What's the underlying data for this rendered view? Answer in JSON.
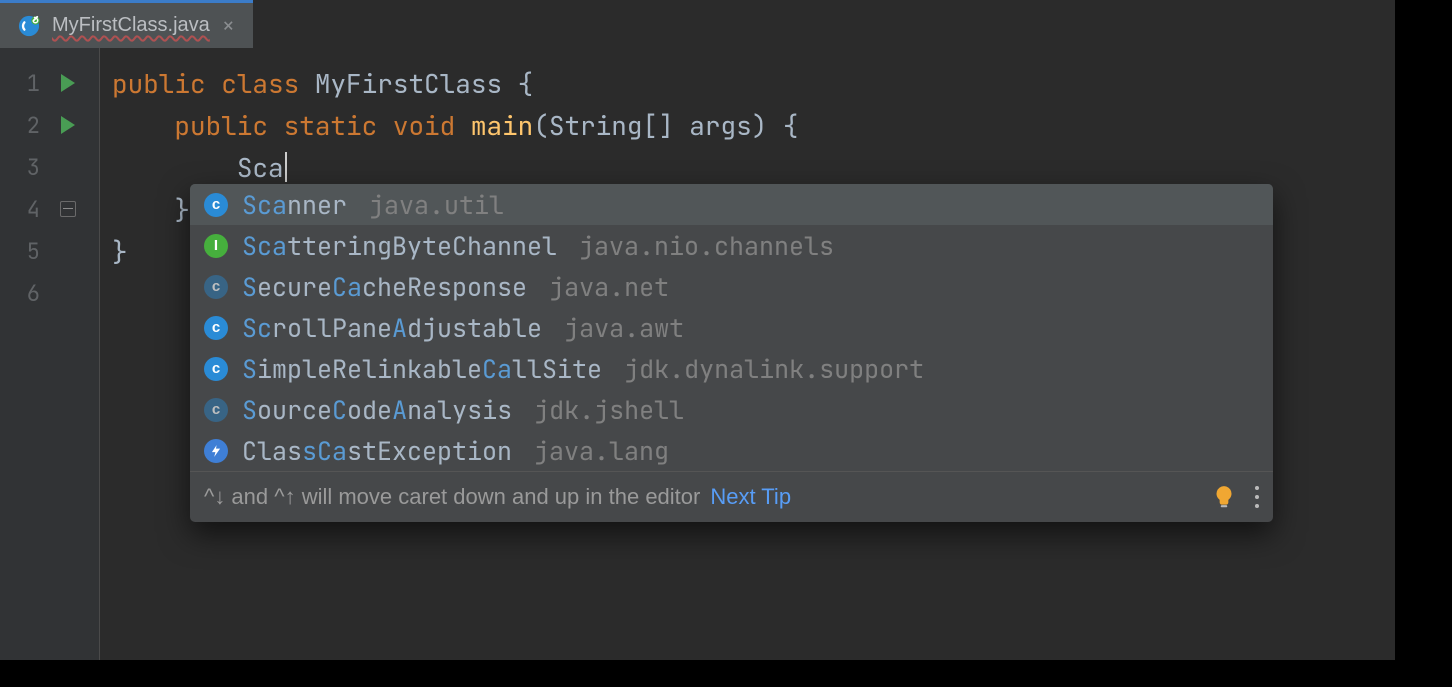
{
  "tab": {
    "filename": "MyFirstClass.java"
  },
  "gutter": {
    "lines": [
      "1",
      "2",
      "3",
      "4",
      "5",
      "6"
    ]
  },
  "code": {
    "l1": {
      "kw1": "public",
      "kw2": "class",
      "name": "MyFirstClass",
      "brace": " {"
    },
    "l2": {
      "indent": "    ",
      "kw1": "public",
      "kw2": "static",
      "kw3": "void",
      "mname": "main",
      "sig": "(String[] args) {"
    },
    "l3": {
      "indent": "        ",
      "typed": "Sca"
    },
    "l4": {
      "indent": "    ",
      "brace": "}"
    },
    "l5": {
      "brace": "}"
    }
  },
  "completion": {
    "items": [
      {
        "badge": "c",
        "badgeClass": "c",
        "dim": false,
        "parts": [
          {
            "t": "Sca",
            "m": true
          },
          {
            "t": "nner",
            "m": false
          }
        ],
        "pkg": "java.util",
        "selected": true
      },
      {
        "badge": "I",
        "badgeClass": "i",
        "dim": false,
        "parts": [
          {
            "t": "Sca",
            "m": true
          },
          {
            "t": "tteringByteChannel",
            "m": false
          }
        ],
        "pkg": "java.nio.channels",
        "selected": false
      },
      {
        "badge": "c",
        "badgeClass": "c",
        "dim": true,
        "parts": [
          {
            "t": "S",
            "m": true
          },
          {
            "t": "ecure",
            "m": false
          },
          {
            "t": "Ca",
            "m": true
          },
          {
            "t": "cheResponse",
            "m": false
          }
        ],
        "pkg": "java.net",
        "selected": false
      },
      {
        "badge": "c",
        "badgeClass": "c",
        "dim": false,
        "parts": [
          {
            "t": "Sc",
            "m": true
          },
          {
            "t": "rollPane",
            "m": false
          },
          {
            "t": "A",
            "m": true
          },
          {
            "t": "djustable",
            "m": false
          }
        ],
        "pkg": "java.awt",
        "selected": false
      },
      {
        "badge": "c",
        "badgeClass": "c",
        "dim": false,
        "parts": [
          {
            "t": "S",
            "m": true
          },
          {
            "t": "impleRelinkable",
            "m": false
          },
          {
            "t": "Ca",
            "m": true
          },
          {
            "t": "llSite",
            "m": false
          }
        ],
        "pkg": "jdk.dynalink.support",
        "selected": false
      },
      {
        "badge": "c",
        "badgeClass": "c",
        "dim": true,
        "parts": [
          {
            "t": "S",
            "m": true
          },
          {
            "t": "ource",
            "m": false
          },
          {
            "t": "C",
            "m": true
          },
          {
            "t": "ode",
            "m": false
          },
          {
            "t": "A",
            "m": true
          },
          {
            "t": "nalysis",
            "m": false
          }
        ],
        "pkg": "jdk.jshell",
        "selected": false
      },
      {
        "badge": "⚡",
        "badgeClass": "lightning",
        "dim": false,
        "parts": [
          {
            "t": "Clas",
            "m": false
          },
          {
            "t": "sCa",
            "m": true
          },
          {
            "t": "stException",
            "m": false
          }
        ],
        "pkg": "java.lang",
        "selected": false
      }
    ],
    "footer": {
      "hint_prefix": "^↓ and ^↑",
      "hint_rest": " will move caret down and up in the editor",
      "next": "Next Tip"
    }
  }
}
